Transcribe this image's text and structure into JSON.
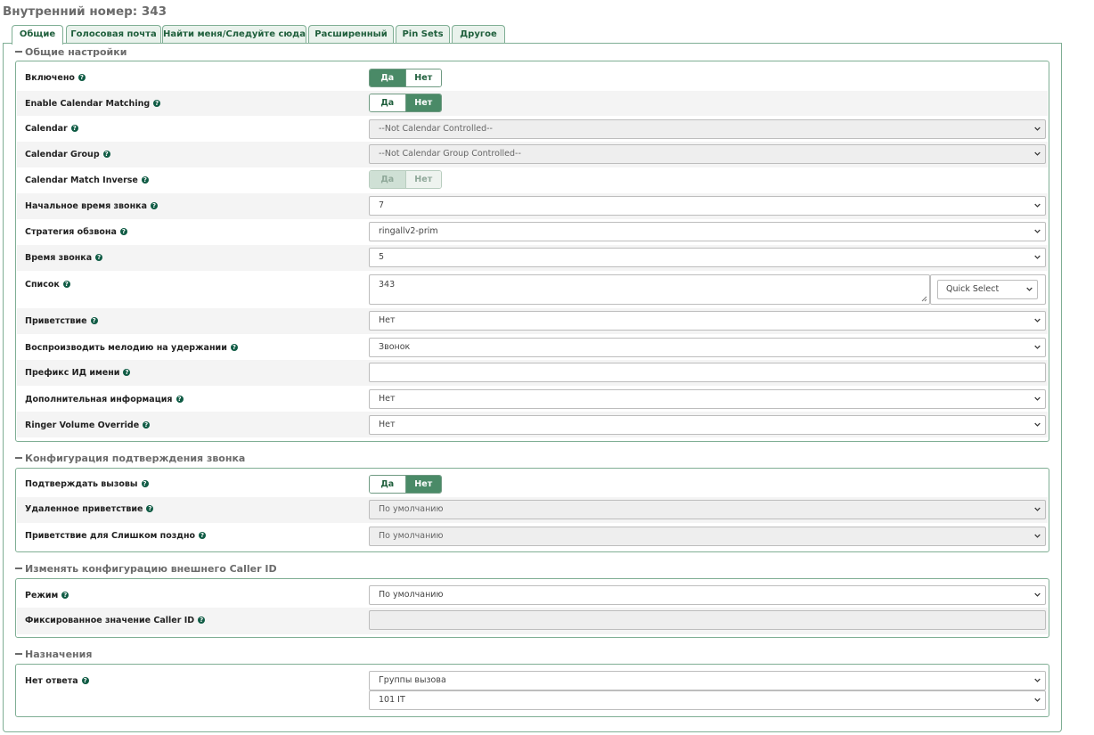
{
  "page": {
    "title": "Внутренний номер: 343"
  },
  "tabs": [
    {
      "label": "Общие"
    },
    {
      "label": "Голосовая почта"
    },
    {
      "label": "Найти меня/Следуйте сюда"
    },
    {
      "label": "Расширенный"
    },
    {
      "label": "Pin Sets"
    },
    {
      "label": "Другое"
    }
  ],
  "toggle": {
    "yes": "Да",
    "no": "Нет"
  },
  "help_glyph": "?",
  "sections": {
    "general": {
      "title": "Общие настройки",
      "enabled": {
        "label": "Включено",
        "value": "Да"
      },
      "calendar_matching": {
        "label": "Enable Calendar Matching",
        "value": "Нет"
      },
      "calendar": {
        "label": "Calendar",
        "value": "--Not Calendar Controlled--"
      },
      "calendar_group": {
        "label": "Calendar Group",
        "value": "--Not Calendar Group Controlled--"
      },
      "calendar_inverse": {
        "label": "Calendar Match Inverse",
        "value": "Нет"
      },
      "ring_start": {
        "label": "Начальное время звонка",
        "value": "7"
      },
      "ring_strategy": {
        "label": "Стратегия обзвона",
        "value": "ringallv2-prim"
      },
      "ring_time": {
        "label": "Время звонка",
        "value": "5"
      },
      "list": {
        "label": "Список",
        "value": "343",
        "quick_select": "Quick Select"
      },
      "announcement": {
        "label": "Приветствие",
        "value": "Нет"
      },
      "moh": {
        "label": "Воспроизводить мелодию на удержании",
        "value": "Звонок"
      },
      "cid_prefix": {
        "label": "Префикс ИД имени",
        "value": ""
      },
      "alert_info": {
        "label": "Дополнительная информация",
        "value": "Нет"
      },
      "ringer_volume": {
        "label": "Ringer Volume Override",
        "value": "Нет"
      }
    },
    "confirm": {
      "title": "Конфигурация подтверждения звонка",
      "confirm_calls": {
        "label": "Подтверждать вызовы",
        "value": "Нет"
      },
      "remote_announce": {
        "label": "Удаленное приветствие",
        "value": "По умолчанию"
      },
      "too_late": {
        "label": "Приветствие для Слишком поздно",
        "value": "По умолчанию"
      }
    },
    "callerid": {
      "title": "Изменять конфигурацию внешнего Caller ID",
      "mode": {
        "label": "Режим",
        "value": "По умолчанию"
      },
      "fixed_cid": {
        "label": "Фиксированное значение Caller ID",
        "value": ""
      }
    },
    "destinations": {
      "title": "Назначения",
      "no_answer": {
        "label": "Нет ответа",
        "category": "Группы вызова",
        "target": "101 IT"
      }
    }
  },
  "colors": {
    "accent": "#4a8a67",
    "border": "#7fae94",
    "help": "#0f5b44"
  }
}
